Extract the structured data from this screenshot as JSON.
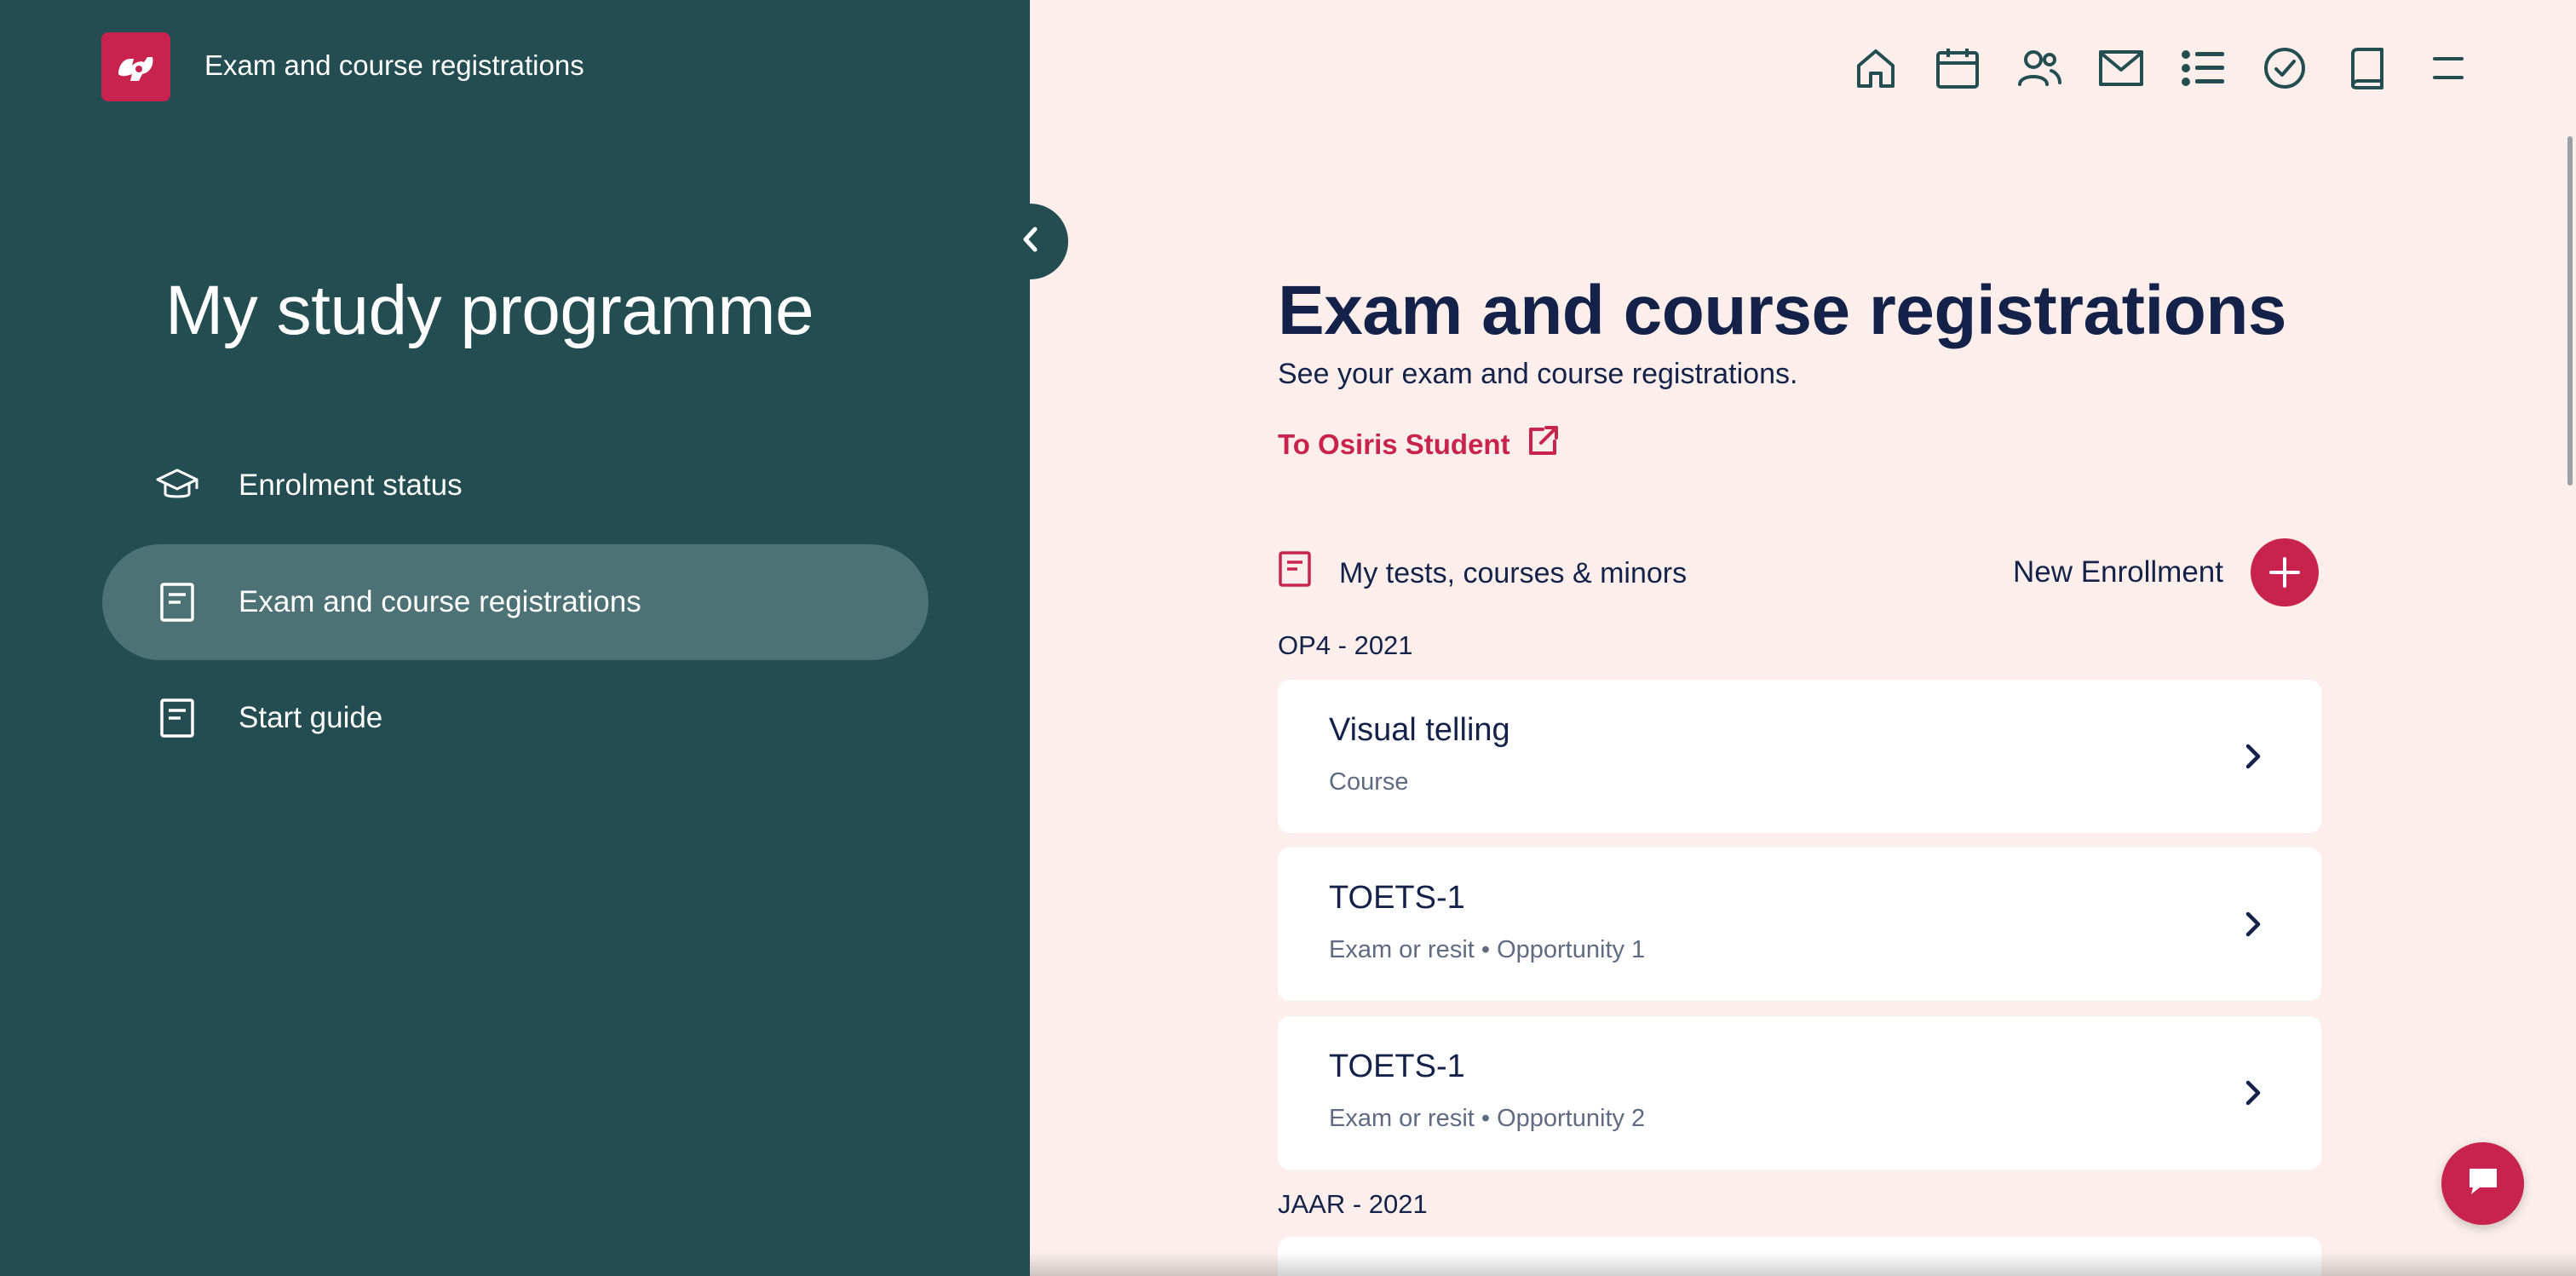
{
  "colors": {
    "sidebar_bg": "#234d51",
    "sidebar_active": "#4d7276",
    "main_bg": "#fcefeb",
    "accent": "#c8234f",
    "text_dark": "#14224a"
  },
  "header": {
    "app_title": "Exam and course registrations",
    "logo_icon": "hu-logo-icon",
    "nav_icons": [
      "home-icon",
      "calendar-icon",
      "people-icon",
      "mail-icon",
      "list-icon",
      "check-circle-icon",
      "book-icon",
      "menu-icon"
    ]
  },
  "sidebar": {
    "heading": "My study programme",
    "items": [
      {
        "label": "Enrolment status",
        "icon": "graduation-cap-icon",
        "active": false
      },
      {
        "label": "Exam and course registrations",
        "icon": "document-icon",
        "active": true
      },
      {
        "label": "Start guide",
        "icon": "document-icon",
        "active": false
      }
    ]
  },
  "main": {
    "title": "Exam and course registrations",
    "subtitle": "See your exam and course registrations.",
    "osiris_link": "To Osiris Student",
    "section_label": "My tests, courses & minors",
    "new_enrollment": "New Enrollment",
    "groups": [
      {
        "label": "OP4 - 2021",
        "items": [
          {
            "title": "Visual telling",
            "subtitle": "Course"
          },
          {
            "title": "TOETS-1",
            "subtitle": "Exam or resit • Opportunity 1"
          },
          {
            "title": "TOETS-1",
            "subtitle": "Exam or resit • Opportunity 2"
          }
        ]
      },
      {
        "label": "JAAR - 2021",
        "items": []
      }
    ]
  }
}
